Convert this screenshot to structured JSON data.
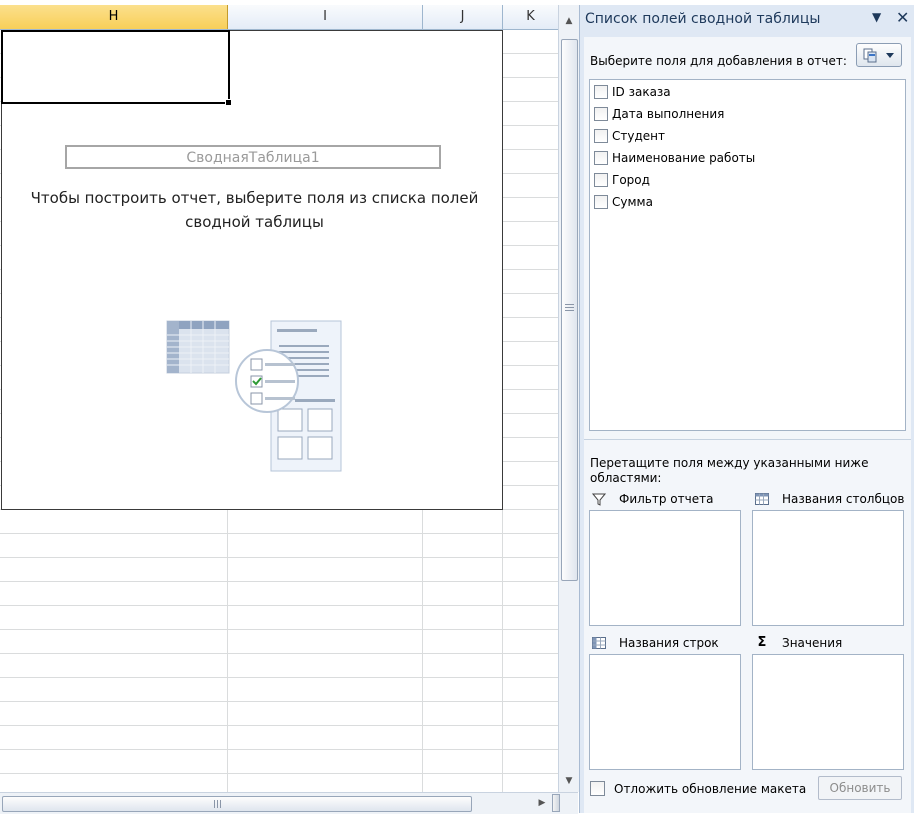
{
  "sheet": {
    "columns": [
      "H",
      "I",
      "J",
      "K"
    ],
    "selected_column": "H",
    "pivot": {
      "name": "СводнаяТаблица1",
      "message_line1": "Чтобы построить отчет, выберите поля из списка полей",
      "message_line2": "сводной таблицы"
    }
  },
  "field_list": {
    "title": "Список полей сводной таблицы",
    "choose_label": "Выберите поля для добавления в отчет:",
    "fields": [
      "ID заказа",
      "Дата выполнения",
      "Студент",
      "Наименование работы",
      "Город",
      "Сумма"
    ],
    "drag_label": "Перетащите поля между указанными ниже областями:",
    "areas": {
      "report_filter": "Фильтр отчета",
      "column_labels": "Названия столбцов",
      "row_labels": "Названия строк",
      "values": "Значения"
    },
    "defer_label": "Отложить обновление макета",
    "update_button": "Обновить"
  },
  "icons": {
    "pane_menu": "dropdown-arrow-icon",
    "pane_close": "close-icon",
    "layout": "layout-options-icon",
    "filter": "funnel-icon",
    "columns": "column-grid-icon",
    "rows": "row-grid-icon",
    "values": "sigma-icon"
  },
  "colors": {
    "selected_header": "#f8cf58",
    "pane_bg": "#dfe8f4",
    "title_text": "#1e395b"
  }
}
